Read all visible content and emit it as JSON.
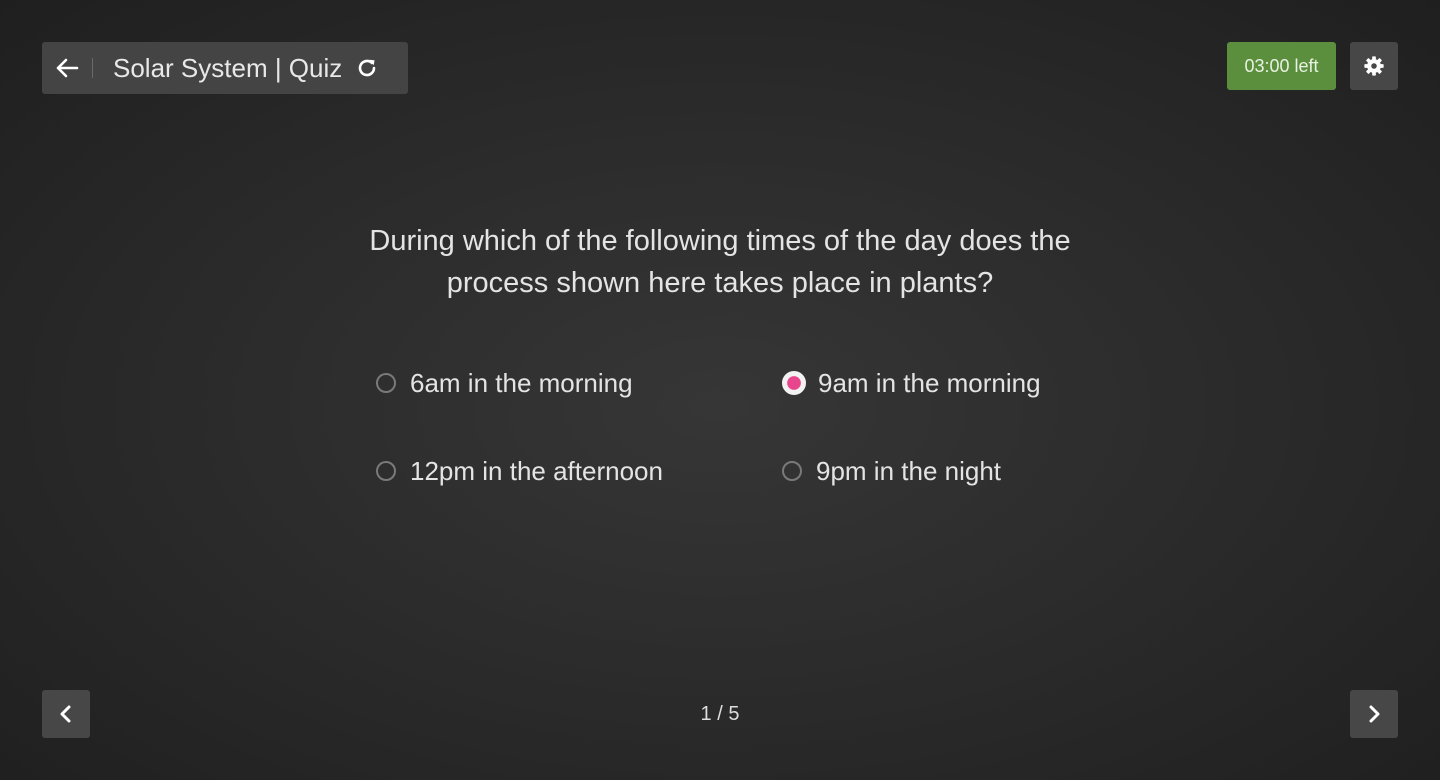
{
  "header": {
    "title": "Solar System | Quiz",
    "back_icon": "arrow-left-icon",
    "refresh_icon": "refresh-icon"
  },
  "timer": {
    "label": "03:00 left",
    "color": "#5b8f3e"
  },
  "settings": {
    "icon": "gear-icon"
  },
  "question": {
    "line1": "During which of the following times of the day does the",
    "line2": "process shown here takes place in plants?"
  },
  "options": [
    {
      "label": "6am in the morning",
      "selected": false
    },
    {
      "label": "9am in the morning",
      "selected": true
    },
    {
      "label": "12pm in the afternoon",
      "selected": false
    },
    {
      "label": "9pm in the night",
      "selected": false
    }
  ],
  "selected_color": "#e8458c",
  "pagination": {
    "label": "1 / 5",
    "prev_icon": "chevron-left-icon",
    "next_icon": "chevron-right-icon"
  }
}
